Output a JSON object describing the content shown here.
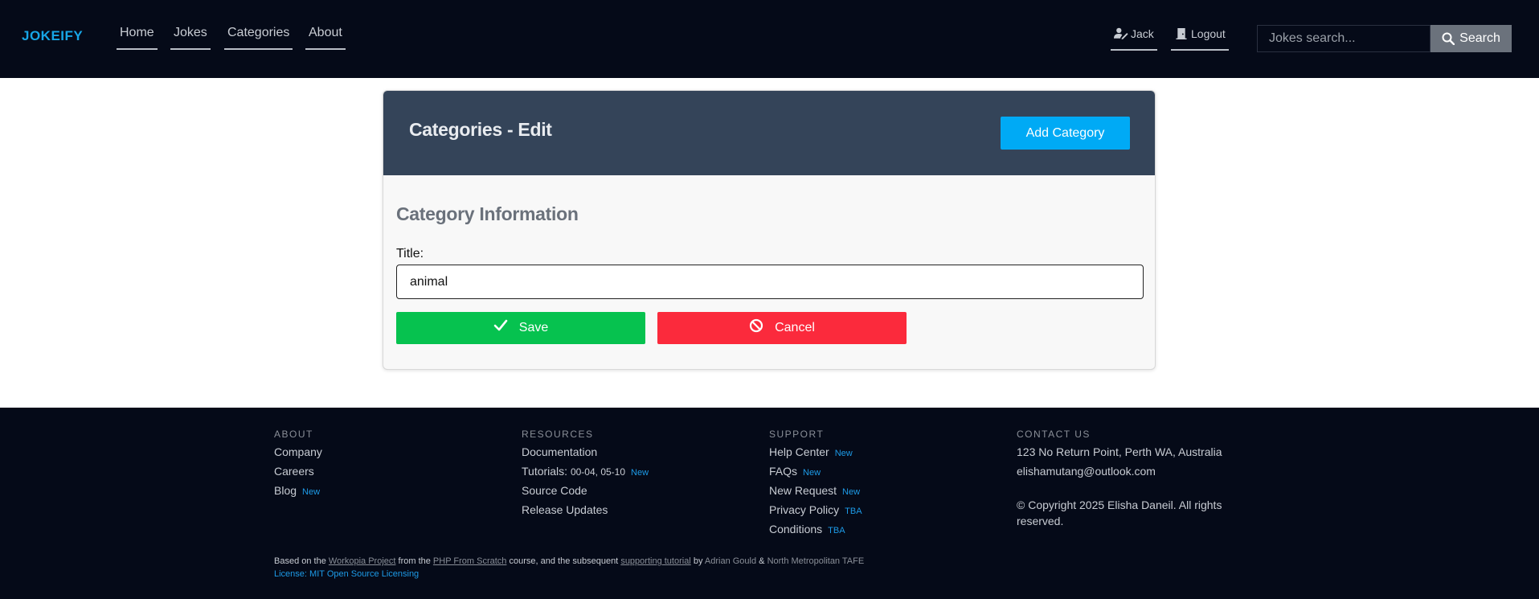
{
  "nav": {
    "brand": "JOKEIFY",
    "links": [
      "Home",
      "Jokes",
      "Categories",
      "About"
    ],
    "user": "Jack",
    "logout": "Logout",
    "search_placeholder": "Jokes search...",
    "search_label": "Search"
  },
  "card": {
    "title": "Categories - Edit",
    "add_button": "Add Category",
    "section_title": "Category Information",
    "field_label": "Title:",
    "field_value": "animal",
    "save_label": "Save",
    "cancel_label": "Cancel"
  },
  "footer": {
    "about": {
      "heading": "ABOUT",
      "items": [
        "Company",
        "Careers",
        "Blog"
      ],
      "blog_badge": "New"
    },
    "resources": {
      "heading": "RESOURCES",
      "documentation": "Documentation",
      "tutorials": "Tutorials:",
      "tutorials_detail": "00-04, 05-10",
      "tutorials_badge": "New",
      "source_code": "Source Code",
      "release_updates": "Release Updates"
    },
    "support": {
      "heading": "SUPPORT",
      "items": [
        {
          "label": "Help Center",
          "badge": "New"
        },
        {
          "label": "FAQs",
          "badge": "New"
        },
        {
          "label": "New Request",
          "badge": "New"
        },
        {
          "label": "Privacy Policy",
          "badge": "TBA"
        },
        {
          "label": "Conditions",
          "badge": "TBA"
        }
      ]
    },
    "contact": {
      "heading": "CONTACT US",
      "address": "123 No Return Point, Perth WA, Australia",
      "email": "elishamutang@outlook.com",
      "copyright": "© Copyright 2025 Elisha Daneil. All rights reserved."
    },
    "credits": {
      "t1": "Based on the ",
      "link1": "Workopia Project",
      "t2": " from the ",
      "link2": "PHP From Scratch",
      "t3": " course, and the subsequent ",
      "link3": "supporting tutorial",
      "t4": " by ",
      "author": "Adrian Gould",
      "t5": " & ",
      "org": "North Metropolitan TAFE"
    },
    "license": "License: MIT Open Source Licensing"
  },
  "colors": {
    "navbar_bg": "#050a18",
    "brand": "#17a6e6",
    "card_header": "#344459",
    "add_button": "#00aaf5",
    "save_button": "#06c24f",
    "cancel_button": "#fb2a3c",
    "badge": "#1d9be8"
  },
  "icons": {
    "user": "user-edit-icon",
    "logout": "door-icon",
    "search": "search-icon",
    "save": "check-icon",
    "cancel": "ban-icon"
  }
}
